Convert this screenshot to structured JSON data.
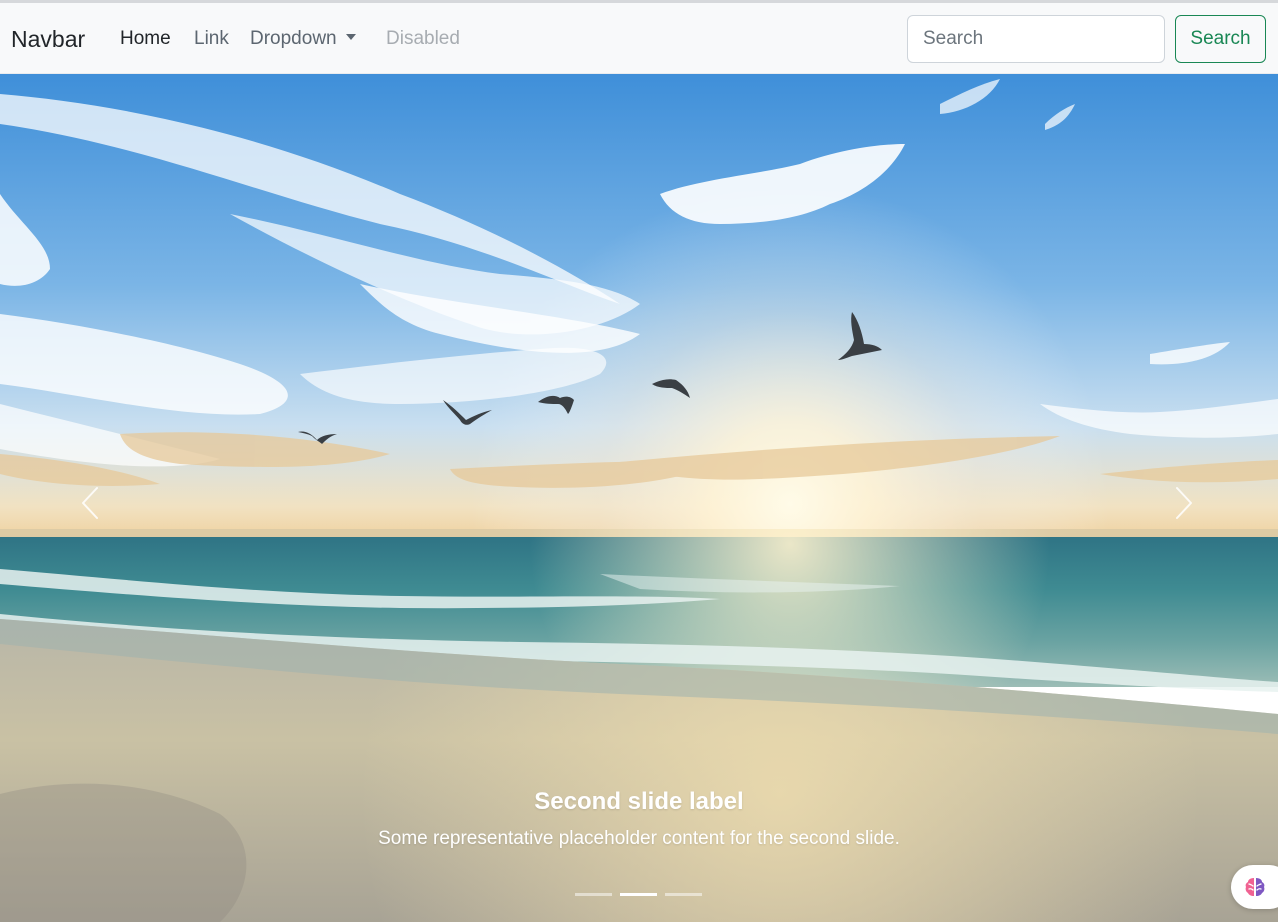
{
  "navbar": {
    "brand": "Navbar",
    "links": [
      {
        "label": "Home",
        "state": "active"
      },
      {
        "label": "Link",
        "state": "normal"
      },
      {
        "label": "Dropdown",
        "state": "normal"
      },
      {
        "label": "Disabled",
        "state": "disabled"
      }
    ],
    "search": {
      "placeholder": "Search",
      "button_label": "Search"
    }
  },
  "carousel": {
    "active_slide": 2,
    "slide_count": 3,
    "image_alt": "Second slide",
    "caption": {
      "title": "Second slide label",
      "text": "Some representative placeholder content for the second slide."
    },
    "controls": {
      "prev_icon": "chevron-left-icon",
      "next_icon": "chevron-right-icon"
    }
  },
  "floating_widget": {
    "icon": "brain-icon"
  },
  "colors": {
    "navbar_bg": "#f8f9fa",
    "success": "#198754",
    "link": "#5c6670",
    "link_active": "#212529",
    "link_disabled": "#a7acb1"
  }
}
